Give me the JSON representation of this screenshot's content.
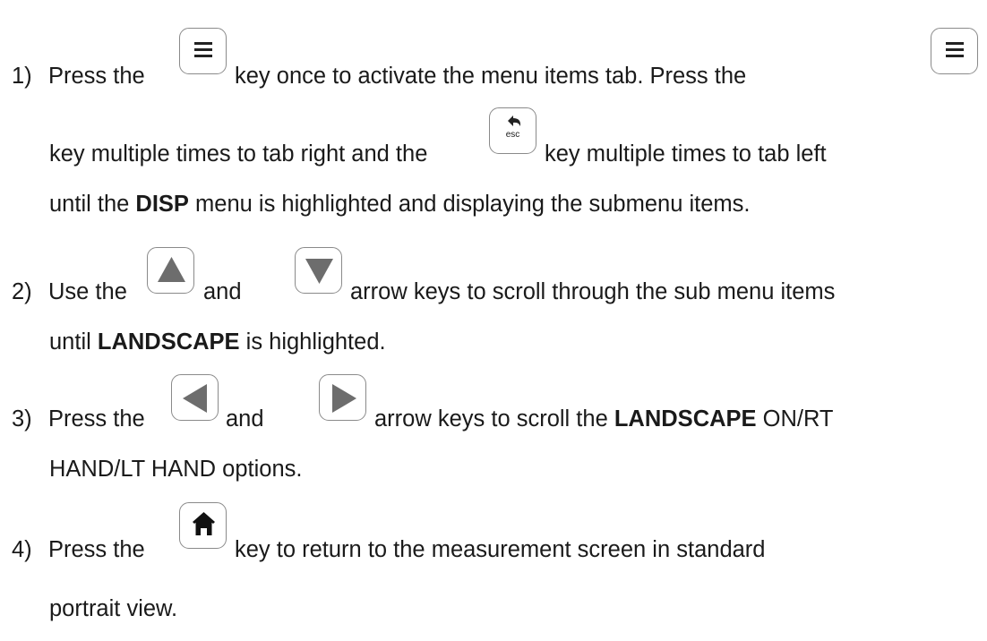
{
  "steps": [
    {
      "number": "1)",
      "line1": {
        "a": "Press the",
        "b": "key once to activate the menu items tab.  Press the"
      },
      "line2": {
        "a": "key multiple times to tab right and the",
        "b": "key multiple times to tab left"
      },
      "line3": {
        "a": "until the",
        "bold": "DISP",
        "b": "menu is highlighted and displaying the submenu items."
      }
    },
    {
      "number": "2)",
      "line1": {
        "a": "Use the",
        "b": "and",
        "c": "arrow keys to scroll through the sub menu items"
      },
      "line2": {
        "a": "until",
        "bold": "LANDSCAPE",
        "b": "is highlighted."
      }
    },
    {
      "number": "3)",
      "line1": {
        "a": "Press the",
        "b": "and",
        "c": "arrow keys to scroll the",
        "bold": "LANDSCAPE",
        "d": "ON/RT"
      },
      "line2": {
        "a": "HAND/LT HAND options."
      }
    },
    {
      "number": "4)",
      "line1": {
        "a": "Press the",
        "b": "key to return to the measurement screen in standard"
      },
      "line2": {
        "a": "portrait view."
      }
    }
  ],
  "keys": {
    "menu": "menu-icon",
    "esc": "esc-back-icon",
    "esc_label": "esc",
    "up": "up-arrow-icon",
    "down": "down-arrow-icon",
    "left": "left-arrow-icon",
    "right": "right-arrow-icon",
    "home": "home-icon"
  }
}
